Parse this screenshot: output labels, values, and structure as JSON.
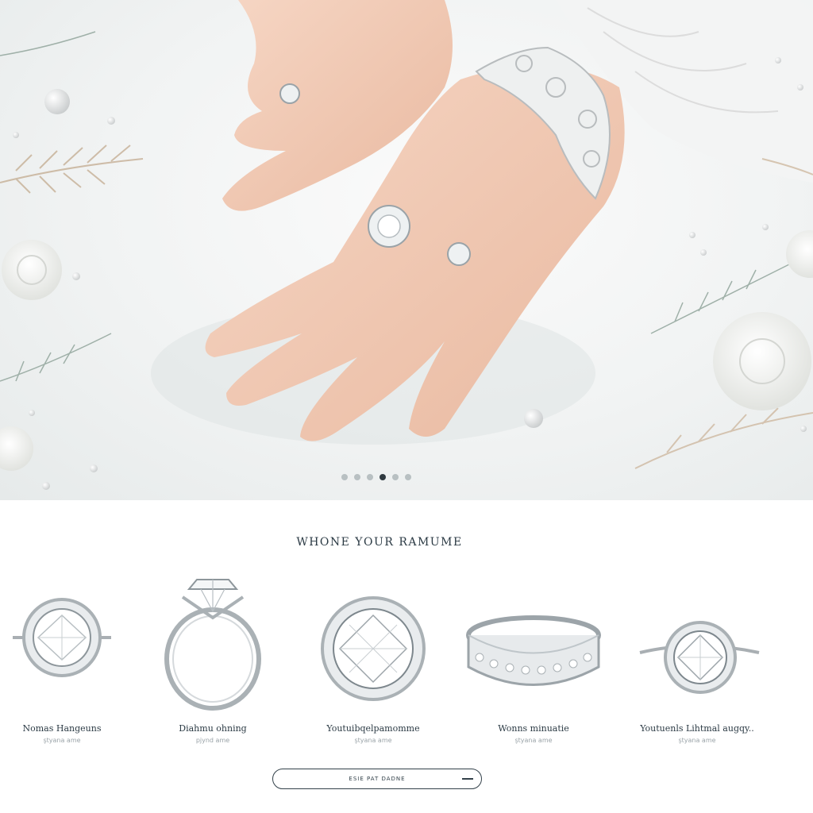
{
  "hero": {
    "slides_total": 6,
    "active_slide_index": 3
  },
  "collection": {
    "title": "WHONE YOUR RAMUME",
    "products": [
      {
        "name": "Nomas Hangeuns",
        "subtitle": "ştyana ame",
        "icon": "halo-round-ring-icon"
      },
      {
        "name": "Diahmu ohning",
        "subtitle": "pjynd ame",
        "icon": "cathedral-solitaire-ring-icon"
      },
      {
        "name": "Youtuibqelpamomme",
        "subtitle": "ştyana ame",
        "icon": "round-halo-diamond-icon"
      },
      {
        "name": "Wonns minuatie",
        "subtitle": "ştyana ame",
        "icon": "eternity-band-icon"
      },
      {
        "name": "Youtuenls Lihtmal augqy..",
        "subtitle": "ştyana ame",
        "icon": "solitaire-pave-ring-icon"
      }
    ],
    "cta_label": "ESIE PAT DADNE"
  },
  "colors": {
    "accent": "#2b3a44",
    "muted": "#9aa3a8",
    "background": "#ffffff"
  }
}
